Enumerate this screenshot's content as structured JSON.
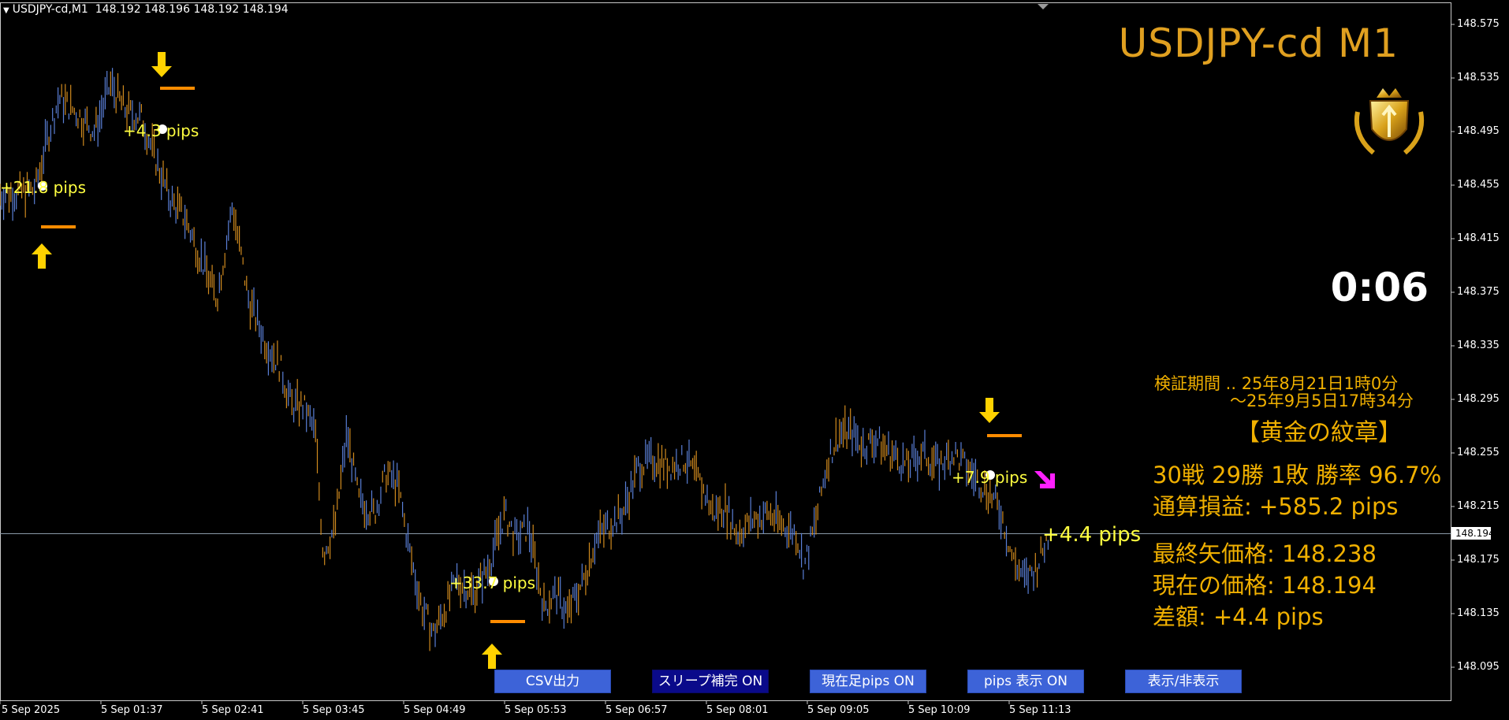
{
  "header": {
    "symbol_info": "USDJPY-cd,M1",
    "ohlc": "148.192 148.196 148.192 148.194"
  },
  "overlay": {
    "title": "USDJPY-cd M1",
    "timer": "0:06",
    "period_line1": "検証期間 .. 25年8月21日1時0分",
    "period_line2": "～25年9月5日17時34分",
    "badge_name": "【黄金の紋章】",
    "record": "30戦 29勝 1敗  勝率 96.7%",
    "total_pl": "通算損益:  +585.2 pips",
    "last_arrow_price": "最終矢価格: 148.238",
    "current_price": "現在の価格: 148.194",
    "difference": "差額:      +4.4 pips",
    "live_pips": "+4.4 pips"
  },
  "signals": [
    {
      "type": "buy",
      "label": "+21.8 pips"
    },
    {
      "type": "sell",
      "label": "+4.3 pips"
    },
    {
      "type": "buy",
      "label": "+33.7 pips"
    },
    {
      "type": "sell",
      "label": "+7.9 pips"
    }
  ],
  "price_axis": {
    "ticks": [
      "148.575",
      "148.535",
      "148.495",
      "148.455",
      "148.415",
      "148.375",
      "148.335",
      "148.295",
      "148.255",
      "148.215",
      "148.175",
      "148.135",
      "148.095"
    ],
    "current_price_label": "148.194"
  },
  "time_axis": {
    "ticks": [
      "5 Sep 2025",
      "5 Sep 01:37",
      "5 Sep 02:41",
      "5 Sep 03:45",
      "5 Sep 04:49",
      "5 Sep 05:53",
      "5 Sep 06:57",
      "5 Sep 08:01",
      "5 Sep 09:05",
      "5 Sep 10:09",
      "5 Sep 11:13"
    ]
  },
  "buttons": {
    "csv": "CSV出力",
    "slip": "スリープ補完 ON",
    "current_bar": "現在足pips ON",
    "pips_display": "pips 表示  ON",
    "toggle": "表示/非表示"
  },
  "colors": {
    "bull_candle": "#5a7fd6",
    "bear_candle": "#d08a1e",
    "arrow_yellow": "#ffd200",
    "dash_orange": "#ff8c00",
    "label_yellow": "#ffff40",
    "magenta_arrow": "#ff20ff",
    "stats_gold": "#f0b000"
  },
  "chart_data": {
    "type": "candlestick",
    "price_path": [
      [
        0,
        148.448
      ],
      [
        20,
        148.449
      ],
      [
        45,
        148.452
      ],
      [
        60,
        148.49
      ],
      [
        75,
        148.52
      ],
      [
        95,
        148.51
      ],
      [
        120,
        148.495
      ],
      [
        140,
        148.53
      ],
      [
        160,
        148.51
      ],
      [
        180,
        148.505
      ],
      [
        200,
        148.47
      ],
      [
        215,
        148.445
      ],
      [
        235,
        148.43
      ],
      [
        255,
        148.4
      ],
      [
        275,
        148.37
      ],
      [
        295,
        148.44
      ],
      [
        315,
        148.37
      ],
      [
        335,
        148.34
      ],
      [
        355,
        148.32
      ],
      [
        370,
        148.29
      ],
      [
        385,
        148.29
      ],
      [
        400,
        148.27
      ],
      [
        410,
        148.18
      ],
      [
        425,
        148.2
      ],
      [
        440,
        148.27
      ],
      [
        455,
        148.22
      ],
      [
        475,
        148.21
      ],
      [
        490,
        148.24
      ],
      [
        505,
        148.23
      ],
      [
        520,
        148.18
      ],
      [
        535,
        148.14
      ],
      [
        550,
        148.12
      ],
      [
        565,
        148.14
      ],
      [
        580,
        148.16
      ],
      [
        600,
        148.15
      ],
      [
        620,
        148.17
      ],
      [
        640,
        148.21
      ],
      [
        655,
        148.19
      ],
      [
        670,
        148.2
      ],
      [
        690,
        148.14
      ],
      [
        705,
        148.15
      ],
      [
        720,
        148.135
      ],
      [
        740,
        148.16
      ],
      [
        755,
        148.19
      ],
      [
        770,
        148.2
      ],
      [
        790,
        148.21
      ],
      [
        810,
        148.245
      ],
      [
        830,
        148.25
      ],
      [
        850,
        148.245
      ],
      [
        870,
        148.25
      ],
      [
        890,
        148.23
      ],
      [
        905,
        148.21
      ],
      [
        920,
        148.215
      ],
      [
        935,
        148.195
      ],
      [
        955,
        148.205
      ],
      [
        975,
        148.21
      ],
      [
        995,
        148.2
      ],
      [
        1010,
        148.195
      ],
      [
        1020,
        148.17
      ],
      [
        1035,
        148.205
      ],
      [
        1050,
        148.25
      ],
      [
        1065,
        148.27
      ],
      [
        1080,
        148.27
      ],
      [
        1095,
        148.26
      ],
      [
        1110,
        148.265
      ],
      [
        1130,
        148.255
      ],
      [
        1150,
        148.245
      ],
      [
        1170,
        148.255
      ],
      [
        1190,
        148.245
      ],
      [
        1210,
        148.255
      ],
      [
        1235,
        148.238
      ],
      [
        1255,
        148.225
      ],
      [
        1270,
        148.21
      ],
      [
        1285,
        148.175
      ],
      [
        1300,
        148.16
      ],
      [
        1315,
        148.17
      ],
      [
        1330,
        148.194
      ]
    ],
    "y_range": [
      148.085,
      148.59
    ]
  }
}
